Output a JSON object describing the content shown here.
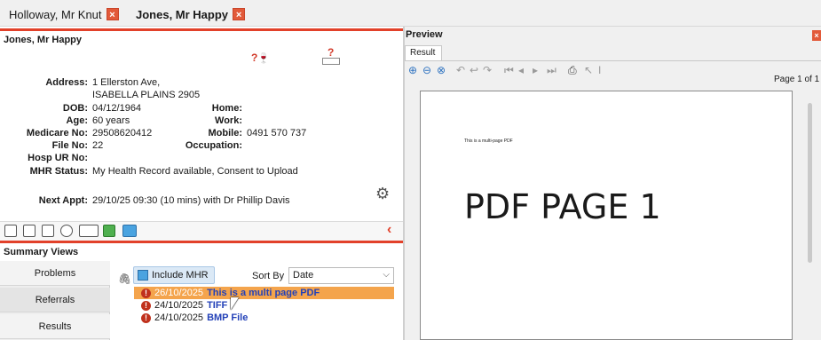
{
  "patient_tabs": [
    {
      "label": "Holloway, Mr Knut",
      "close": "×"
    },
    {
      "label": "Jones, Mr Happy",
      "close": "×"
    }
  ],
  "patient": {
    "name": "Jones, Mr Happy",
    "address_label": "Address:",
    "address_line1": "1 Ellerston Ave,",
    "address_line2": "ISABELLA PLAINS  2905",
    "dob_label": "DOB:",
    "dob": "04/12/1964",
    "age_label": "Age:",
    "age": "60 years",
    "medicare_label": "Medicare No:",
    "medicare": "29508620412",
    "file_label": "File No:",
    "file": "22",
    "hosp_label": "Hosp UR No:",
    "hosp": "",
    "mhr_label": "MHR Status:",
    "mhr": "My Health Record available, Consent to Upload",
    "home_label": "Home:",
    "home": "",
    "work_label": "Work:",
    "work": "",
    "mobile_label": "Mobile:",
    "mobile": "0491 570 737",
    "occupation_label": "Occupation:",
    "occupation": "",
    "next_appt_label": "Next Appt:",
    "next_appt": "29/10/25 09:30 (10 mins) with Dr Phillip Davis",
    "alert_icons": [
      "?",
      "?"
    ]
  },
  "summary": {
    "title": "Summary Views",
    "tabs": [
      "Problems",
      "Referrals",
      "Results"
    ],
    "include_mhr": "Include MHR",
    "sort_by_label": "Sort By",
    "sort_by_value": "Date",
    "results": [
      {
        "date": "26/10/2025",
        "title": "This is a multi page PDF",
        "selected": true
      },
      {
        "date": "24/10/2025",
        "title": "TIFF",
        "selected": false
      },
      {
        "date": "24/10/2025",
        "title": "BMP File",
        "selected": false
      }
    ]
  },
  "preview": {
    "title": "Preview",
    "close": "×",
    "tab": "Result",
    "page_info": "Page 1 of 1",
    "doc_small_text": "This is a multi-page PDF",
    "doc_big_text": "PDF PAGE 1"
  }
}
